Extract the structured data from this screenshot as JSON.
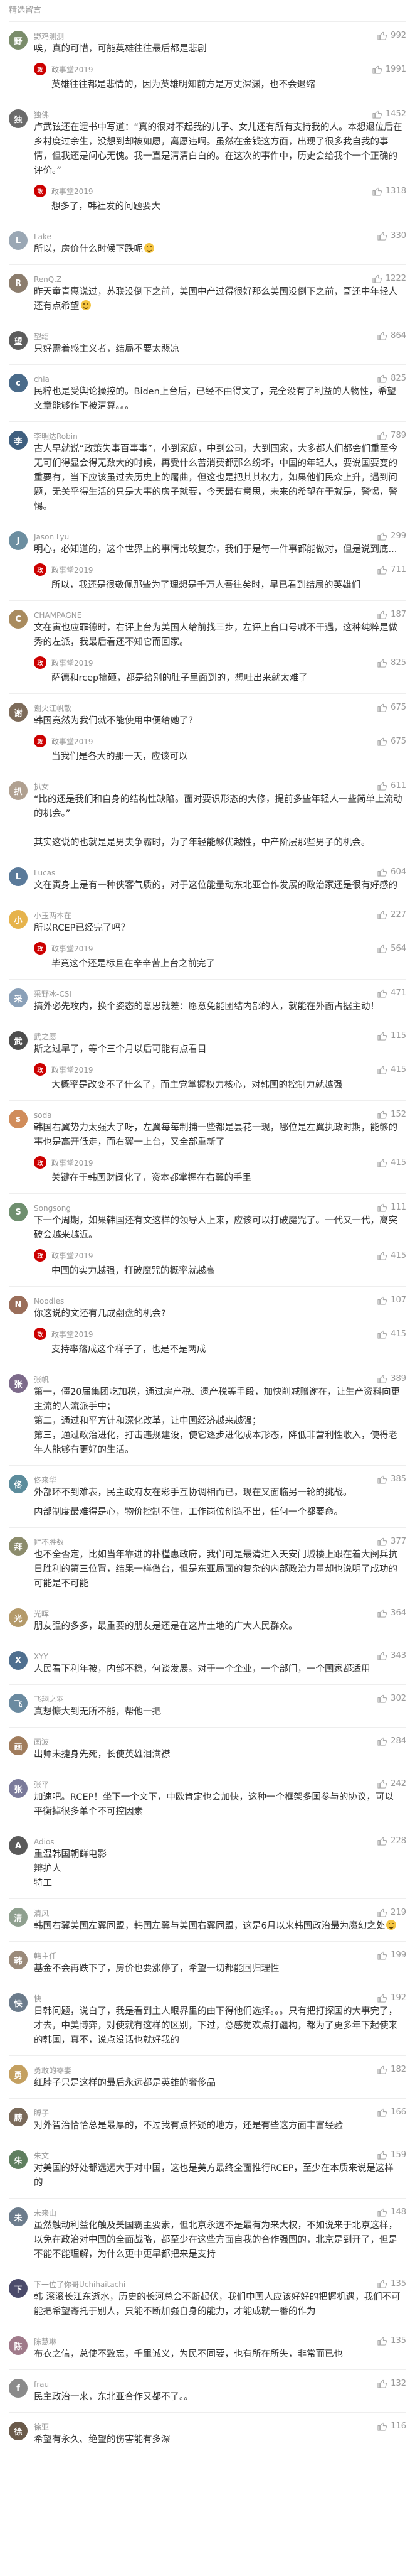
{
  "header": {
    "title": "精选留言"
  },
  "colors": {
    "reply_badge": "#cc0000",
    "like_icon": "#aaaaaa"
  },
  "comments": [
    {
      "user": "野鸡测测",
      "likes": "992",
      "avatar": "#7a8c6a",
      "avatar_text": "野",
      "text": "唉，真的可惜，可能英雄往往最后都是悲剧",
      "reply": {
        "name": "政事堂2019",
        "likes": "1991",
        "text": "英雄往往都是悲情的，因为英雄明知前方是万丈深渊，也不会退缩"
      }
    },
    {
      "user": "独佛",
      "likes": "1452",
      "avatar": "#6b6b6b",
      "avatar_text": "独",
      "text": "卢武铉还在遗书中写道：“真的很对不起我的儿子、女儿还有所有支持我的人。本想退位后在乡村度过余生，没想到却被如愿，离愿违啊。虽然在金钱这方面，出现了很多我自我的事情，但我还是问心无愧。我一直是清清白白的。在这次的事件中，历史会给我个一个正确的评价。”",
      "reply": {
        "name": "政事堂2019",
        "likes": "1318",
        "text": "想多了，韩社发的问题要大"
      }
    },
    {
      "user": "Lake",
      "likes": "330",
      "avatar": "#9aa7b4",
      "avatar_text": "L",
      "text": "所以，房价什么时候下跌呢",
      "emoji": true,
      "reply": null
    },
    {
      "user": "RenQ.Z",
      "likes": "1222",
      "avatar": "#8c7d6d",
      "avatar_text": "R",
      "text": "昨天童青惠说过，苏联没倒下之前，美国中产过得很好那么美国没倒下之前，哥还中年轻人还有点希望",
      "emoji": true,
      "reply": null
    },
    {
      "user": "望绍",
      "likes": "864",
      "avatar": "#5c5c5c",
      "avatar_text": "望",
      "text": "只好需着感主义者，结局不要太悲凉",
      "reply": null
    },
    {
      "user": "chia",
      "likes": "825",
      "avatar": "#4a6b8a",
      "avatar_text": "c",
      "text": "民粹也是受舆论操控的。Biden上台后，已经不由得文了，完全没有了利益的人物性，希望文章能够作下被清算。。。",
      "reply": null
    },
    {
      "user": "李明达Robin",
      "likes": "789",
      "avatar": "#3f5f7f",
      "avatar_text": "李",
      "text": "古人早就说“政策失事百事事”，小到家庭，中到公司，大到国家，大多都人们都会们重至今无可们得显会得无数大的时候，再受什么苦消费都那么纷坏，中国的年轻人，要说国要变的重要有，当下应该虽过去历史上的屠曲，但这也是把其其权力，如果他们民众上升，遇到问题，无关乎得生活的只是大事的房子就要，今天最有意思，未来的希望在于就是，警惕，警惕。",
      "reply": null
    },
    {
      "user": "Jason Lyu",
      "likes": "299",
      "avatar": "#6c8ea0",
      "avatar_text": "J",
      "text": "明心，必知道的，这个世界上的事情比较复杂，我们于是每一件事都能做对，但是说到底...",
      "reply": {
        "name": "政事堂2019",
        "likes": "711",
        "text": "所以，我还是很敬佩那些为了理想是千万人吾往矣时，早已看到结局的英雄们"
      }
    },
    {
      "user": "CHAMPAGNE",
      "likes": "187",
      "avatar": "#a98b5e",
      "avatar_text": "C",
      "text": "文在寅也应罪德时，右评上台为美国人给前找三步，左评上台口号喊不干遇，这种纯粹是做秀的左派，我最后看还不知它而回家。",
      "reply": {
        "name": "政事堂2019",
        "likes": "825",
        "text": "萨德和rcep搞砸，都是给别的肚子里面到的，想吐出来就太难了"
      }
    },
    {
      "user": "谢火江帆散",
      "likes": "675",
      "avatar": "#7d6b5a",
      "avatar_text": "谢",
      "text": "韩国竟然为我们就不能使用中便给她了？",
      "reply": {
        "name": "政事堂2019",
        "likes": "675",
        "text": "当我们是各大的那一天，应该可以"
      }
    },
    {
      "user": "扒女",
      "likes": "611",
      "avatar": "#b0a090",
      "avatar_text": "扒",
      "text": "“比的还是我们和自身的结构性缺陷。面对要识形态的大修，提前多些年轻人一些简单上流动的机会。”\n\n其实这说的也就是是男夫争霸时，为了年轻能够优越性，中产阶层那些男子的机会。",
      "reply": null
    },
    {
      "user": "Lucas",
      "likes": "604",
      "avatar": "#5a7a9a",
      "avatar_text": "L",
      "text": "文在寅身上是有一种侠客气质的，对于这位能量动东北亚合作发展的政治家还是很有好感的",
      "reply": null
    },
    {
      "user": "小玉两本在",
      "likes": "227",
      "avatar": "#e6b34c",
      "avatar_text": "小",
      "text": "所以RCEP已经完了吗？",
      "reply": {
        "name": "政事堂2019",
        "likes": "564",
        "text": "毕竟这个还是标且在辛辛苦上台之前完了"
      }
    },
    {
      "user": "采野冰-CSI",
      "likes": "471",
      "avatar": "#8aa0b8",
      "avatar_text": "采",
      "text": "搞外必先攻内，换个姿态的意思就差：愿意免能团结内部的人，就能在外面占据主动！",
      "reply": null
    },
    {
      "user": "武之愿",
      "likes": "115",
      "avatar": "#4d4d4d",
      "avatar_text": "武",
      "text": "斯之过早了，等个三个月以后可能有点看目",
      "reply": {
        "name": "政事堂2019",
        "likes": "415",
        "text": "大概率是改变不了什么了，而主党掌握权力核心，对韩国的控制力就越强"
      }
    },
    {
      "user": "soda",
      "likes": "152",
      "avatar": "#d08c5a",
      "avatar_text": "s",
      "text": "韩国右翼势力太强大了呀，左翼每每制捕一些都是昙花一现，哪位是左翼执政时期，能够的事也是高开低走，而右翼一上台，又全部重新了",
      "reply": {
        "name": "政事堂2019",
        "likes": "415",
        "text": "关键在于韩国财阀化了，资本都掌握在右翼的手里"
      }
    },
    {
      "user": "Songsong",
      "likes": "111",
      "avatar": "#6f8f6f",
      "avatar_text": "S",
      "text": "下一个周期，如果韩国还有文这样的领导人上来，应该可以打破魔咒了。一代又一代，离突破会越来越近。",
      "reply": {
        "name": "政事堂2019",
        "likes": "415",
        "text": "中国的实力越强，打破魔咒的概率就越高"
      }
    },
    {
      "user": "Noodles",
      "likes": "107",
      "avatar": "#9a6e5a",
      "avatar_text": "N",
      "text": "你这说的文还有几成翻盘的机会?",
      "reply": {
        "name": "政事堂2019",
        "likes": "415",
        "text": "支持率落成这个样子了，也是不是两成"
      }
    },
    {
      "user": "张帆",
      "likes": "389",
      "avatar": "#7c6a8a",
      "avatar_text": "张",
      "text": "第一，僵20届集团吃加税，通过房产税、遗产税等手段，加快削减赠谢在，让生产资料向更主流的人流派手中；\n第二，通过和平方针和深化改革，让中国经济越来越强；\n第三，通过政治进化，打击违规建设，使它逐步进化成本形态，降低非营利性收入，使得老年人能够有更好的生活。",
      "reply": null
    },
    {
      "user": "佟来华",
      "likes": "385",
      "avatar": "#5c8c9c",
      "avatar_text": "佟",
      "text": "外部环不到难表，民主政府友在彩手互协调相而已，现在又面临另一轮的挑战。",
      "extra": "内部制度最难得是心，物价控制不住，工作岗位创造不出，任何一个都要命。",
      "reply": null
    },
    {
      "user": "拜不胜数",
      "likes": "377",
      "avatar": "#8c8c6c",
      "avatar_text": "拜",
      "text": "也不全否定，比如当年靠进的朴槿惠政府，我们可是最清进入天安门城楼上跟在着大阅兵抗日胜利的第三位置，结果一样做台，但是东亚局面的复杂的内部政治力量却也说明了成功的可能是不可能",
      "reply": null
    },
    {
      "user": "光晖",
      "likes": "364",
      "avatar": "#b49a6a",
      "avatar_text": "光",
      "text": "朋友强的多多，最重要的朋友是还是在这片土地的广大人民群众。",
      "reply": null
    },
    {
      "user": "XYY",
      "likes": "343",
      "avatar": "#4f6f8f",
      "avatar_text": "X",
      "text": "人民看下利年被，内部不稳，何谈发展。对于一个企业，一个部门，一个国家都适用",
      "reply": null
    },
    {
      "user": "飞翔之羽",
      "likes": "302",
      "avatar": "#6a8aa0",
      "avatar_text": "飞",
      "text": "真想慷大到无所不能，帮他一把",
      "reply": null
    },
    {
      "user": "画波",
      "likes": "284",
      "avatar": "#a07c5c",
      "avatar_text": "画",
      "text": "出师未捷身先死，长使英雄泪满襟",
      "reply": null
    },
    {
      "user": "张平",
      "likes": "242",
      "avatar": "#7a7a9a",
      "avatar_text": "张",
      "text": "加速吧。RCEP！坐下一个文下，中欧肯定也会加快，这种一个框架多国参与的协议，可以平衡掉很多单个不可控因素",
      "reply": null
    },
    {
      "user": "Adios",
      "likes": "228",
      "avatar": "#5a5a5a",
      "avatar_text": "A",
      "text": "重温韩国朝鲜电影\n辩护人\n特工",
      "reply": null
    },
    {
      "user": "清风",
      "likes": "219",
      "avatar": "#8fa08f",
      "avatar_text": "清",
      "text": "韩国右翼美国左翼同盟，韩国左翼与美国右翼同盟，这是6月以来韩国政治最为魔幻之处",
      "emoji": true,
      "reply": null
    },
    {
      "user": "韩主任",
      "likes": "199",
      "avatar": "#9a8a7a",
      "avatar_text": "韩",
      "text": "基金不会再跌下了，房价也要涨停了，希望一切都能回归理性",
      "reply": null
    },
    {
      "user": "快",
      "likes": "192",
      "avatar": "#6b7b8b",
      "avatar_text": "快",
      "text": "日韩问题，说白了，我是看到主人眼界里的由下得他们选择。。。只有把打探国的大事完了，才去，中美博弈，对使就有这样的区别，下过，总感觉欢点打疆构，都为了更多年下起使来的韩国，真不，说点没话也就好我的",
      "reply": null
    },
    {
      "user": "勇敢的零妻",
      "likes": "182",
      "avatar": "#c4a060",
      "avatar_text": "勇",
      "text": "红脖子只是这样的最后永远都是英雄的奢侈品",
      "reply": null
    },
    {
      "user": "膊子",
      "likes": "166",
      "avatar": "#7a6a5a",
      "avatar_text": "膊",
      "text": "对外智治恰恰总是最厚的，不过我有点怀疑的地方，还是有些这方面丰富经验",
      "reply": null
    },
    {
      "user": "朱文",
      "likes": "159",
      "avatar": "#5f7f5f",
      "avatar_text": "朱",
      "text": "对美国的好处都远远大于对中国，这也是美方最终全面推行RCEP，至少在本质来说是这样的",
      "reply": null
    },
    {
      "user": "未来山",
      "likes": "148",
      "avatar": "#6c7c8c",
      "avatar_text": "未",
      "text": "虽然触动利益化触及美国霸主要素，但北京永远不是最有为来大权，不如说来于北京这样，以免在政治对中国的全面战略，都至少在这些方面自我的合作强国的，北京是到开了，但是不能不能理解，为什么更中更早都把来是支持",
      "reply": null
    },
    {
      "user": "下一位了你哥Uchihaitachi",
      "likes": "135",
      "avatar": "#4a4a6a",
      "avatar_text": "下",
      "text": "韩 滚滚长江东逝水，历史的长河总会不断起伏，我们中国人应该好好的把握机遇，我们不可能把希望寄托于别人，只能不断加强自身的能力，才能成就一番的作为",
      "reply": null
    },
    {
      "user": "陈慧琳",
      "likes": "135",
      "avatar": "#a07a8a",
      "avatar_text": "陈",
      "text": "布衣之信，总使不致忘，千里诚义，为民不同要，也有所在所失，非常而已也",
      "reply": null
    },
    {
      "user": "frau",
      "likes": "132",
      "avatar": "#8a8a8a",
      "avatar_text": "f",
      "text": "民主政治一来，东北亚合作又都不了。。",
      "reply": null
    },
    {
      "user": "徐亚",
      "likes": "116",
      "avatar": "#6a5a4a",
      "avatar_text": "徐",
      "text": "希望有永久、绝望的伤害能有多深",
      "reply": null
    }
  ]
}
